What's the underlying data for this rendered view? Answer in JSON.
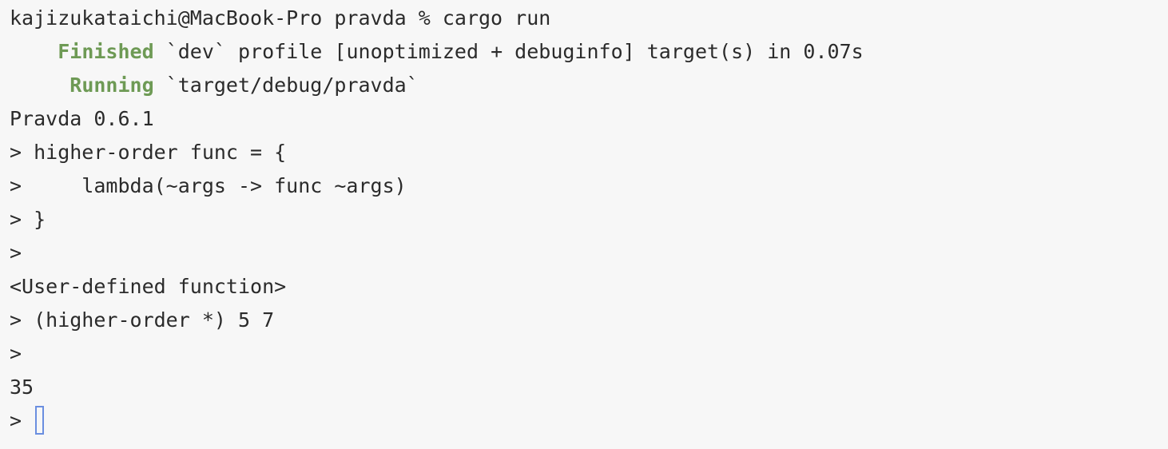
{
  "terminal": {
    "lines": [
      {
        "text": "kajizukataichi@MacBook-Pro pravda % cargo run"
      },
      {
        "indent": "    ",
        "status": "Finished",
        "rest": " `dev` profile [unoptimized + debuginfo] target(s) in 0.07s"
      },
      {
        "indent": "     ",
        "status": "Running",
        "rest": " `target/debug/pravda`"
      },
      {
        "text": "Pravda 0.6.1"
      },
      {
        "text": "> higher-order func = {"
      },
      {
        "text": ">     lambda(~args -> func ~args)"
      },
      {
        "text": "> }"
      },
      {
        "text": ">"
      },
      {
        "text": "<User-defined function>"
      },
      {
        "text": "> (higher-order *) 5 7"
      },
      {
        "text": ">"
      },
      {
        "text": "35"
      },
      {
        "text": "> "
      }
    ]
  },
  "colors": {
    "background": "#f7f7f7",
    "text": "#2b2b2b",
    "status_green": "#6e9a55",
    "cursor": "#6b8fe0"
  }
}
